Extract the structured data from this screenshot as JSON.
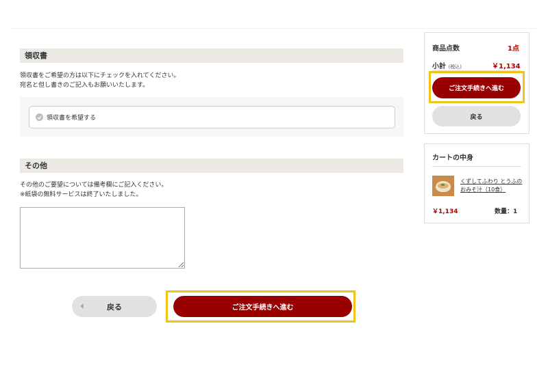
{
  "receipt": {
    "heading": "領収書",
    "line1": "領収書をご希望の方は以下にチェックを入れてください。",
    "line2": "宛名と但し書きのご記入もお願いいたします。",
    "option_label": "領収書を希望する",
    "option_checked": false
  },
  "other": {
    "heading": "その他",
    "line1": "その他のご要望については備考欄にご記入ください。",
    "line2": "※紙袋の無料サービスは終了いたしました。",
    "remarks_value": ""
  },
  "actions": {
    "back_label": "戻る",
    "proceed_label": "ご注文手続きへ進む"
  },
  "summary": {
    "item_count_label": "商品点数",
    "item_count_value": "1点",
    "subtotal_label": "小計",
    "subtotal_tax_note": "(税込)",
    "subtotal_value": "￥1,134",
    "proceed_label": "ご注文手続きへ進む",
    "back_label": "戻る"
  },
  "cart": {
    "title": "カートの中身",
    "items": [
      {
        "name": "くずしてふわり とうふのおみそ汁（10食）",
        "price": "￥1,134",
        "quantity": "数量：1"
      }
    ]
  },
  "colors": {
    "accent": "#990000",
    "price": "#b30000",
    "highlight": "#f0c419",
    "section_bg": "#ece9e4"
  },
  "icons": {
    "receipt_option": "check-circle-icon",
    "back_button": "arrow-left-icon"
  }
}
